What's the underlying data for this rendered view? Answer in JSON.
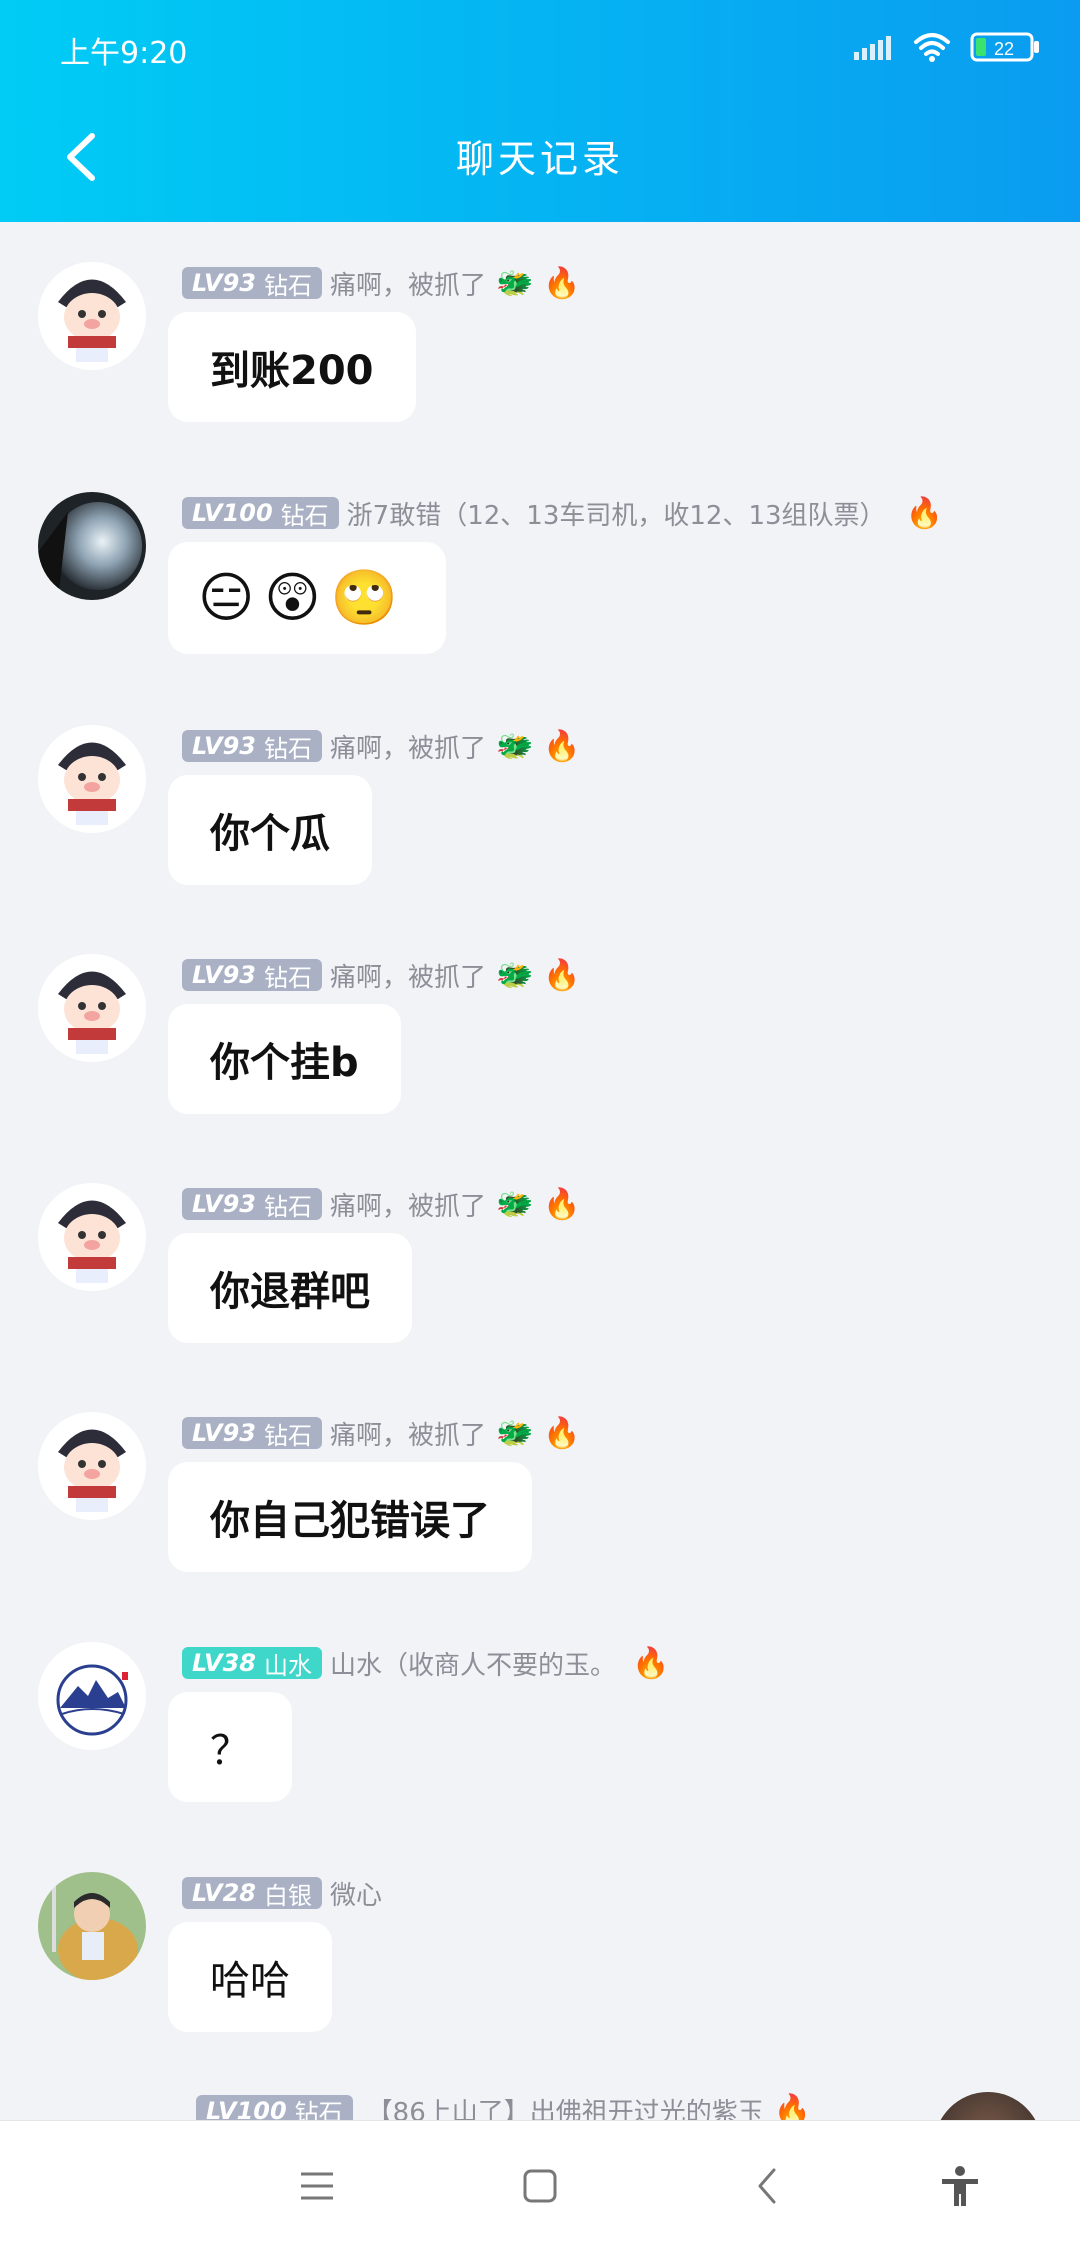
{
  "status_bar": {
    "time": "上午9:20",
    "battery": "22"
  },
  "header": {
    "title": "聊天记录",
    "back_icon": "chevron-left-icon"
  },
  "messages": [
    {
      "level": "LV93",
      "rank": "钻石",
      "nickname": "痛啊，被抓了",
      "badges": [
        "🐲",
        "🔥"
      ],
      "text": "到账200",
      "avatar": "cartoon-pig"
    },
    {
      "level": "LV100",
      "rank": "钻石",
      "nickname": "浙7敢错（12、13车司机，收12、13组队票）",
      "badges": [
        "🔥"
      ],
      "text": "",
      "emojis": [
        "😑",
        "😲",
        "🙄"
      ],
      "avatar": "glass-orb"
    },
    {
      "level": "LV93",
      "rank": "钻石",
      "nickname": "痛啊，被抓了",
      "badges": [
        "🐲",
        "🔥"
      ],
      "text": "你个瓜",
      "avatar": "cartoon-pig"
    },
    {
      "level": "LV93",
      "rank": "钻石",
      "nickname": "痛啊，被抓了",
      "badges": [
        "🐲",
        "🔥"
      ],
      "text": "你个挂b",
      "avatar": "cartoon-pig"
    },
    {
      "level": "LV93",
      "rank": "钻石",
      "nickname": "痛啊，被抓了",
      "badges": [
        "🐲",
        "🔥"
      ],
      "text": "你退群吧",
      "avatar": "cartoon-pig"
    },
    {
      "level": "LV93",
      "rank": "钻石",
      "nickname": "痛啊，被抓了",
      "badges": [
        "🐲",
        "🔥"
      ],
      "text": "你自己犯错误了",
      "avatar": "cartoon-pig"
    },
    {
      "level": "LV38",
      "rank": "山水",
      "nickname": "山水（收商人不要的玉。",
      "badges": [
        "🔥"
      ],
      "text": "？",
      "avatar": "mountain-logo",
      "level_color": "#3fd7c9"
    },
    {
      "level": "LV28",
      "rank": "白银",
      "nickname": "微心",
      "badges": [],
      "text": "哈哈",
      "avatar": "baby-photo"
    }
  ],
  "partial_message": {
    "level": "LV100",
    "rank": "钻石",
    "nickname": "【86上山了】出佛祖开过光的紫玉",
    "badges": [
      "🔥"
    ]
  },
  "navbar": {
    "items": [
      "menu-icon",
      "home-square-icon",
      "back-chevron-icon",
      "accessibility-icon"
    ]
  },
  "colors": {
    "header_start": "#00ccf5",
    "header_end": "#0a9cf0",
    "level_default": "#aab1c4",
    "level_shanshui": "#3fd7c9",
    "background": "#f2f3f7"
  }
}
